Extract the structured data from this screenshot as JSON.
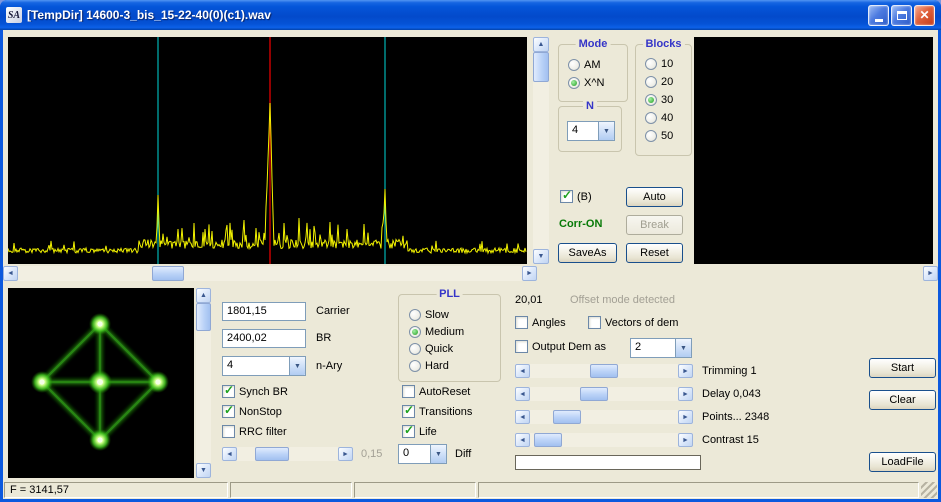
{
  "window": {
    "title": "[TempDir] 14600-3_bis_15-22-40(0)(c1).wav",
    "icon": "SA"
  },
  "controls": {
    "mode": {
      "label": "Mode",
      "options": [
        {
          "label": "AM",
          "selected": false
        },
        {
          "label": "X^N",
          "selected": true
        }
      ]
    },
    "blocks": {
      "label": "Blocks",
      "options": [
        {
          "label": "10",
          "selected": false
        },
        {
          "label": "20",
          "selected": false
        },
        {
          "label": "30",
          "selected": true
        },
        {
          "label": "40",
          "selected": false
        },
        {
          "label": "50",
          "selected": false
        }
      ]
    },
    "n": {
      "label": "N",
      "value": "4"
    },
    "b_checkbox": {
      "label": "(B)",
      "checked": true
    },
    "auto_button": "Auto",
    "corr_status": "Corr-ON",
    "break_button": "Break",
    "saveas_button": "SaveAs",
    "reset_button": "Reset"
  },
  "demod": {
    "carrier": {
      "value": "1801,15",
      "label": "Carrier"
    },
    "br": {
      "value": "2400,02",
      "label": "BR"
    },
    "nary": {
      "value": "4",
      "label": "n-Ary"
    },
    "pll": {
      "label": "PLL",
      "options": [
        {
          "label": "Slow",
          "selected": false
        },
        {
          "label": "Medium",
          "selected": true
        },
        {
          "label": "Quick",
          "selected": false
        },
        {
          "label": "Hard",
          "selected": false
        }
      ]
    },
    "left_checks": [
      {
        "label": "Synch BR",
        "checked": true
      },
      {
        "label": "NonStop",
        "checked": true
      },
      {
        "label": "RRC filter",
        "checked": false
      }
    ],
    "right_checks": [
      {
        "label": "AutoReset",
        "checked": false
      },
      {
        "label": "Transitions",
        "checked": true
      },
      {
        "label": "Life",
        "checked": true
      }
    ],
    "rrc_value": "0,15",
    "diff": {
      "value": "0",
      "label": "Diff"
    }
  },
  "output": {
    "offset_value": "20,01",
    "offset_status": "Offset mode detected",
    "angles": {
      "label": "Angles",
      "checked": false
    },
    "vectors": {
      "label": "Vectors of dem",
      "checked": false
    },
    "output_dem": {
      "label": "Output Dem as",
      "checked": false,
      "value": "2"
    },
    "sliders": [
      {
        "label": "Trimming 1"
      },
      {
        "label": "Delay 0,043"
      },
      {
        "label": "Points... 2348"
      },
      {
        "label": "Contrast 15"
      }
    ],
    "start_button": "Start",
    "clear_button": "Clear",
    "loadfile_button": "LoadFile"
  },
  "status": {
    "f_value": "F = 3141,57"
  },
  "colors": {
    "accent_blue": "#3535C8",
    "status_green": "#077A07",
    "trace_yellow": "#F2F200",
    "marker_cyan": "#00D8D8",
    "marker_red": "#C40000",
    "constellation_green": "#2E9C18"
  }
}
